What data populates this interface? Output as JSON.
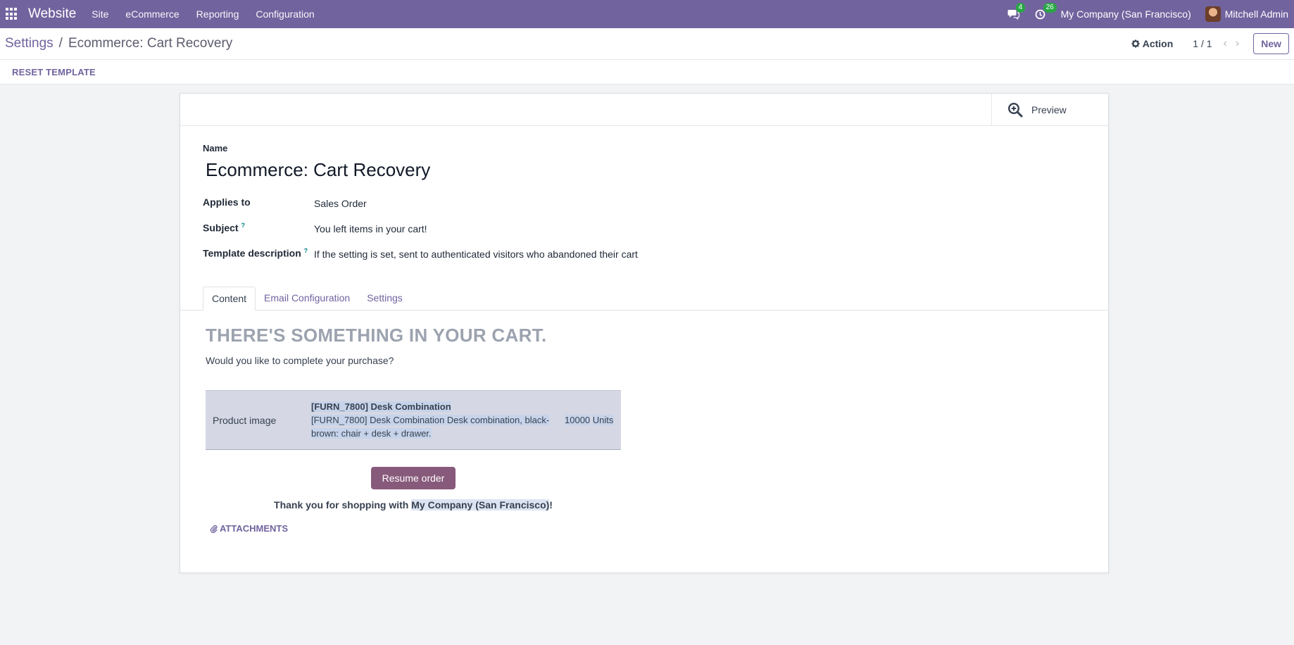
{
  "navbar": {
    "brand": "Website",
    "menu": [
      "Site",
      "eCommerce",
      "Reporting",
      "Configuration"
    ],
    "messages_count": "4",
    "activities_count": "26",
    "company": "My Company (San Francisco)",
    "user": "Mitchell Admin",
    "badge_color": "#28a745",
    "bar_color": "#71639e"
  },
  "control_panel": {
    "breadcrumb_parent": "Settings",
    "breadcrumb_separator": "/",
    "breadcrumb_current": "Ecommerce: Cart Recovery",
    "action_label": "Action",
    "pager": "1 / 1",
    "new_label": "New"
  },
  "statusbar": {
    "reset_label": "RESET TEMPLATE"
  },
  "form": {
    "preview_label": "Preview",
    "name_label": "Name",
    "name_value": "Ecommerce: Cart Recovery",
    "applies_to_label": "Applies to",
    "applies_to_value": "Sales Order",
    "subject_label": "Subject",
    "subject_value": "You left items in your cart!",
    "description_label": "Template description",
    "description_value": "If the setting is set, sent to authenticated visitors who abandoned their cart",
    "help_marker": "?"
  },
  "tabs": [
    "Content",
    "Email Configuration",
    "Settings"
  ],
  "mail": {
    "title": "THERE'S SOMETHING IN YOUR CART.",
    "subtitle": "Would you like to complete your purchase?",
    "product_image_label": "Product image",
    "product_name": "[FURN_7800] Desk Combination",
    "product_description": "[FURN_7800] Desk Combination Desk combination, black-brown: chair + desk + drawer.",
    "quantity": "10000",
    "unit": "Units",
    "resume_label": "Resume order",
    "thanks_prefix": "Thank you for shopping with ",
    "thanks_company": "My Company (San Francisco)",
    "thanks_suffix": "!",
    "attachments_label": "ATTACHMENTS",
    "button_color": "#875a7b"
  }
}
